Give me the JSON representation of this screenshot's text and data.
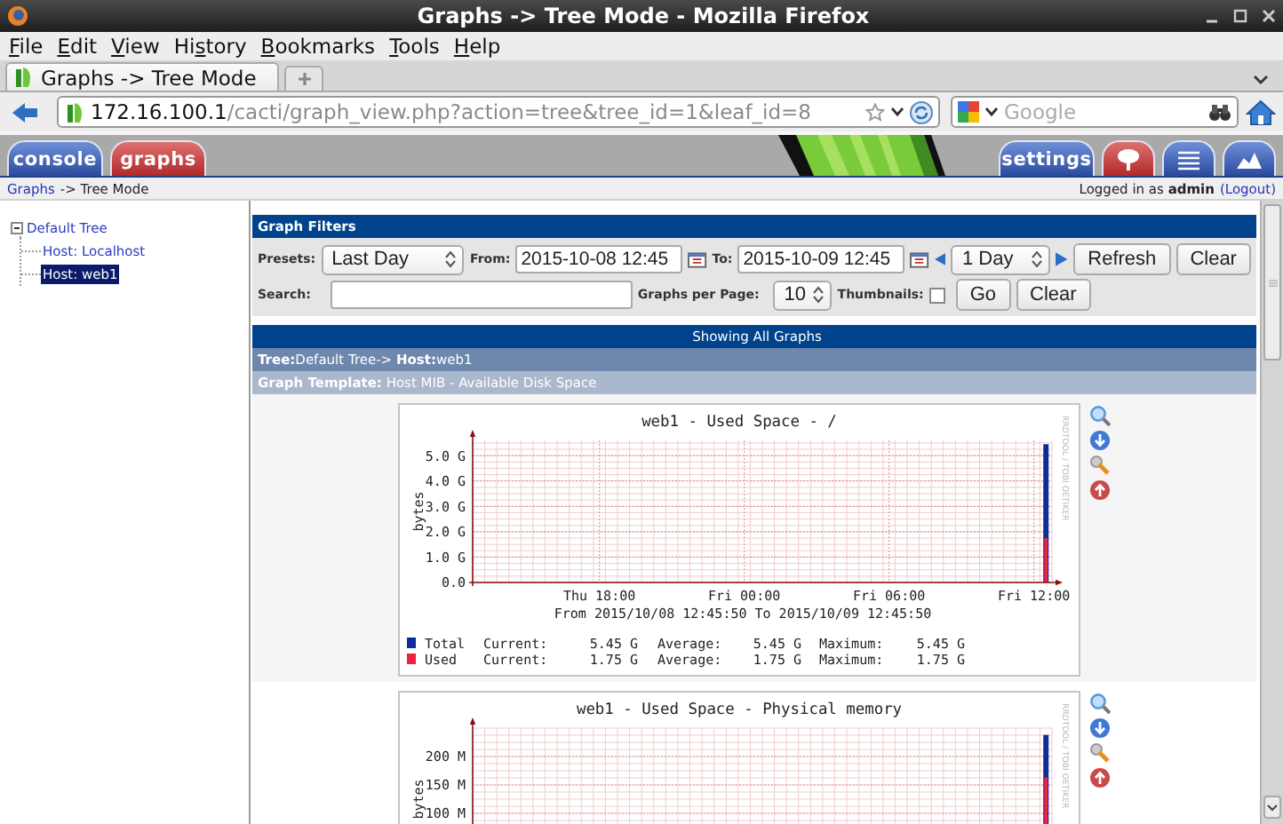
{
  "window": {
    "title": "Graphs -> Tree Mode - Mozilla Firefox"
  },
  "menu": [
    {
      "key": "F",
      "after": "ile"
    },
    {
      "key": "E",
      "after": "dit"
    },
    {
      "key": "V",
      "after": "iew"
    },
    {
      "before": "Hi",
      "key": "s",
      "after": "tory"
    },
    {
      "key": "B",
      "after": "ookmarks"
    },
    {
      "key": "T",
      "after": "ools"
    },
    {
      "key": "H",
      "after": "elp"
    }
  ],
  "browser_tabs": [
    {
      "label": "Graphs -> Tree Mode",
      "selected": true
    }
  ],
  "address_bar": {
    "host": "172.16.100.1",
    "path": "/cacti/graph_view.php?action=tree&tree_id=1&leaf_id=8"
  },
  "search_bar": {
    "placeholder": "Google"
  },
  "nav_tabs": [
    {
      "label": "console",
      "selected": false
    },
    {
      "label": "graphs",
      "selected": true
    }
  ],
  "right_tabs": [
    {
      "kind": "text",
      "label": "settings",
      "selected": false
    },
    {
      "kind": "tree",
      "selected": true
    },
    {
      "kind": "list",
      "selected": false
    },
    {
      "kind": "preview",
      "selected": false
    }
  ],
  "breadcrumb": {
    "link": "Graphs",
    "rest": "-> Tree Mode"
  },
  "login": {
    "text": "Logged in as **admin**",
    "logout": "(Logout)"
  },
  "tree": [
    {
      "label": "Default Tree",
      "expanded": true,
      "children": [
        {
          "label": "Host: Localhost",
          "selected": false
        },
        {
          "label": "Host: web1",
          "selected": true
        }
      ]
    }
  ],
  "filters": {
    "title": "Graph Filters",
    "presets_label": "Presets:",
    "preset": "Last Day",
    "from_label": "From:",
    "from": "2015-10-08 12:45",
    "to_label": "To:",
    "to": "2015-10-09 12:45",
    "timespan": "1 Day",
    "refresh": "Refresh",
    "clear": "Clear",
    "search_label": "Search:",
    "per_page_label": "Graphs per Page:",
    "per_page": "10",
    "thumbnails_label": "Thumbnails:",
    "thumbnails_checked": false,
    "go": "Go",
    "clear_search": "Clear"
  },
  "listing": {
    "header": "Showing All Graphs",
    "tree_path": "**Tree:**Default Tree-> **Host:**web1",
    "template": "**Graph Template:** Host MIB - Available Disk Space"
  },
  "graphs": [
    {
      "credit": "RRDTOOL / TOBI OETIKER",
      "chart_data": {
        "type": "bar",
        "title": "web1 - Used Space - /",
        "ylabel": "bytes",
        "xlabel": "From 2015/10/08 12:45:50 To 2015/10/09 12:45:50",
        "stacked": false,
        "grid": true,
        "legend": "bottom",
        "categories": [
          null,
          null,
          null,
          null,
          null,
          null,
          null,
          null,
          null,
          null,
          null,
          null,
          null,
          null,
          null,
          null,
          null,
          null,
          null,
          null,
          null,
          "Thu 18:00",
          null,
          null,
          null,
          null,
          null,
          null,
          null,
          null,
          null,
          null,
          null,
          null,
          null,
          null,
          null,
          null,
          null,
          null,
          null,
          null,
          null,
          null,
          null,
          "Fri 00:00",
          null,
          null,
          null,
          null,
          null,
          null,
          null,
          null,
          null,
          null,
          null,
          null,
          null,
          null,
          null,
          null,
          null,
          null,
          null,
          null,
          null,
          null,
          null,
          "Fri 06:00",
          null,
          null,
          null,
          null,
          null,
          null,
          null,
          null,
          null,
          null,
          null,
          null,
          null,
          null,
          null,
          null,
          null,
          null,
          null,
          null,
          null,
          null,
          null,
          "Fri 12:00",
          null,
          null
        ],
        "series": [
          {
            "name": "Total",
            "color": "#0c2c9c",
            "values": [
              null,
              null,
              null,
              null,
              null,
              null,
              null,
              null,
              null,
              null,
              null,
              null,
              null,
              null,
              null,
              null,
              null,
              null,
              null,
              null,
              null,
              null,
              null,
              null,
              null,
              null,
              null,
              null,
              null,
              null,
              null,
              null,
              null,
              null,
              null,
              null,
              null,
              null,
              null,
              null,
              null,
              null,
              null,
              null,
              null,
              null,
              null,
              null,
              null,
              null,
              null,
              null,
              null,
              null,
              null,
              null,
              null,
              null,
              null,
              null,
              null,
              null,
              null,
              null,
              null,
              null,
              null,
              null,
              null,
              null,
              null,
              null,
              null,
              null,
              null,
              null,
              null,
              null,
              null,
              null,
              null,
              null,
              null,
              null,
              null,
              null,
              null,
              null,
              null,
              null,
              null,
              null,
              null,
              null,
              null,
              5.45
            ]
          },
          {
            "name": "Used",
            "color": "#f02040",
            "values": [
              null,
              null,
              null,
              null,
              null,
              null,
              null,
              null,
              null,
              null,
              null,
              null,
              null,
              null,
              null,
              null,
              null,
              null,
              null,
              null,
              null,
              null,
              null,
              null,
              null,
              null,
              null,
              null,
              null,
              null,
              null,
              null,
              null,
              null,
              null,
              null,
              null,
              null,
              null,
              null,
              null,
              null,
              null,
              null,
              null,
              null,
              null,
              null,
              null,
              null,
              null,
              null,
              null,
              null,
              null,
              null,
              null,
              null,
              null,
              null,
              null,
              null,
              null,
              null,
              null,
              null,
              null,
              null,
              null,
              null,
              null,
              null,
              null,
              null,
              null,
              null,
              null,
              null,
              null,
              null,
              null,
              null,
              null,
              null,
              null,
              null,
              null,
              null,
              null,
              null,
              null,
              null,
              null,
              null,
              null,
              1.75
            ]
          }
        ],
        "ylim": [
          0,
          5.6
        ],
        "yticks": [
          {
            "value": 0,
            "label": "0.0"
          },
          {
            "value": 1,
            "label": "1.0 G"
          },
          {
            "value": 2,
            "label": "2.0 G"
          },
          {
            "value": 3,
            "label": "3.0 G"
          },
          {
            "value": 4,
            "label": "4.0 G"
          },
          {
            "value": 5,
            "label": "5.0 G"
          }
        ]
      },
      "legend": [
        {
          "current_label": "Current:",
          "current": "5.45 G",
          "average_label": "Average:",
          "average": "5.45 G",
          "maximum_label": "Maximum:",
          "maximum": "5.45 G"
        },
        {
          "current_label": "Current:",
          "current": "1.75 G",
          "average_label": "Average:",
          "average": "1.75 G",
          "maximum_label": "Maximum:",
          "maximum": "1.75 G"
        }
      ]
    },
    {
      "credit": "RRDTOOL / TOBI OETIKER",
      "chart_data": {
        "type": "bar",
        "title": "web1 - Used Space - Physical memory",
        "ylabel": "bytes",
        "stacked": false,
        "grid": true,
        "categories": [
          null,
          null,
          null,
          null,
          null,
          null,
          null,
          null,
          null,
          null,
          null,
          null,
          null,
          null,
          null,
          null,
          null,
          null,
          null,
          null,
          null,
          null,
          null,
          null,
          null,
          null,
          null,
          null,
          null,
          null,
          null,
          null,
          null,
          null,
          null,
          null,
          null,
          null,
          null,
          null,
          null,
          null,
          null,
          null,
          null,
          null,
          null,
          null,
          null,
          null,
          null,
          null,
          null,
          null,
          null,
          null,
          null,
          null,
          null,
          null,
          null,
          null,
          null,
          null,
          null,
          null,
          null,
          null,
          null,
          null,
          null,
          null,
          null,
          null,
          null,
          null,
          null,
          null,
          null,
          null,
          null,
          null,
          null,
          null,
          null,
          null,
          null,
          null,
          null,
          null,
          null,
          null,
          null,
          null,
          null,
          null
        ],
        "series": [
          {
            "color": "#0c2c9c",
            "values": [
              null,
              null,
              null,
              null,
              null,
              null,
              null,
              null,
              null,
              null,
              null,
              null,
              null,
              null,
              null,
              null,
              null,
              null,
              null,
              null,
              null,
              null,
              null,
              null,
              null,
              null,
              null,
              null,
              null,
              null,
              null,
              null,
              null,
              null,
              null,
              null,
              null,
              null,
              null,
              null,
              null,
              null,
              null,
              null,
              null,
              null,
              null,
              null,
              null,
              null,
              null,
              null,
              null,
              null,
              null,
              null,
              null,
              null,
              null,
              null,
              null,
              null,
              null,
              null,
              null,
              null,
              null,
              null,
              null,
              null,
              null,
              null,
              null,
              null,
              null,
              null,
              null,
              null,
              null,
              null,
              null,
              null,
              null,
              null,
              null,
              null,
              null,
              null,
              null,
              null,
              null,
              null,
              null,
              null,
              null,
              238
            ]
          },
          {
            "color": "#f02040",
            "values": [
              null,
              null,
              null,
              null,
              null,
              null,
              null,
              null,
              null,
              null,
              null,
              null,
              null,
              null,
              null,
              null,
              null,
              null,
              null,
              null,
              null,
              null,
              null,
              null,
              null,
              null,
              null,
              null,
              null,
              null,
              null,
              null,
              null,
              null,
              null,
              null,
              null,
              null,
              null,
              null,
              null,
              null,
              null,
              null,
              null,
              null,
              null,
              null,
              null,
              null,
              null,
              null,
              null,
              null,
              null,
              null,
              null,
              null,
              null,
              null,
              null,
              null,
              null,
              null,
              null,
              null,
              null,
              null,
              null,
              null,
              null,
              null,
              null,
              null,
              null,
              null,
              null,
              null,
              null,
              null,
              null,
              null,
              null,
              null,
              null,
              null,
              null,
              null,
              null,
              null,
              null,
              null,
              null,
              null,
              null,
              163
            ]
          }
        ],
        "ylim": [
          0,
          250
        ],
        "yticks": [
          {
            "value": 100,
            "label": "100 M"
          },
          {
            "value": 150,
            "label": "150 M"
          },
          {
            "value": 200,
            "label": "200 M"
          }
        ]
      }
    }
  ]
}
